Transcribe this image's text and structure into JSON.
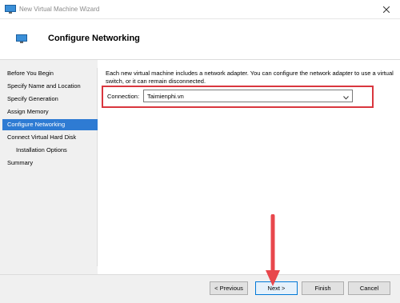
{
  "window": {
    "title": "New Virtual Machine Wizard",
    "icon": "monitor-icon"
  },
  "header": {
    "title": "Configure Networking",
    "icon": "monitor-icon"
  },
  "nav": {
    "items": [
      {
        "label": "Before You Begin",
        "active": false,
        "sub": false
      },
      {
        "label": "Specify Name and Location",
        "active": false,
        "sub": false
      },
      {
        "label": "Specify Generation",
        "active": false,
        "sub": false
      },
      {
        "label": "Assign Memory",
        "active": false,
        "sub": false
      },
      {
        "label": "Configure Networking",
        "active": true,
        "sub": false
      },
      {
        "label": "Connect Virtual Hard Disk",
        "active": false,
        "sub": false
      },
      {
        "label": "Installation Options",
        "active": false,
        "sub": true
      },
      {
        "label": "Summary",
        "active": false,
        "sub": false
      }
    ]
  },
  "main": {
    "description": "Each new virtual machine includes a network adapter. You can configure the network adapter to use a virtual switch, or it can remain disconnected.",
    "connection_label": "Connection:",
    "connection_value": "Taimienphi.vn"
  },
  "footer": {
    "previous_label": "< Previous",
    "next_label": "Next >",
    "finish_label": "Finish",
    "cancel_label": "Cancel"
  },
  "colors": {
    "accent": "#2e7bd3",
    "highlight": "#d9363e",
    "arrow": "#e8474c"
  }
}
